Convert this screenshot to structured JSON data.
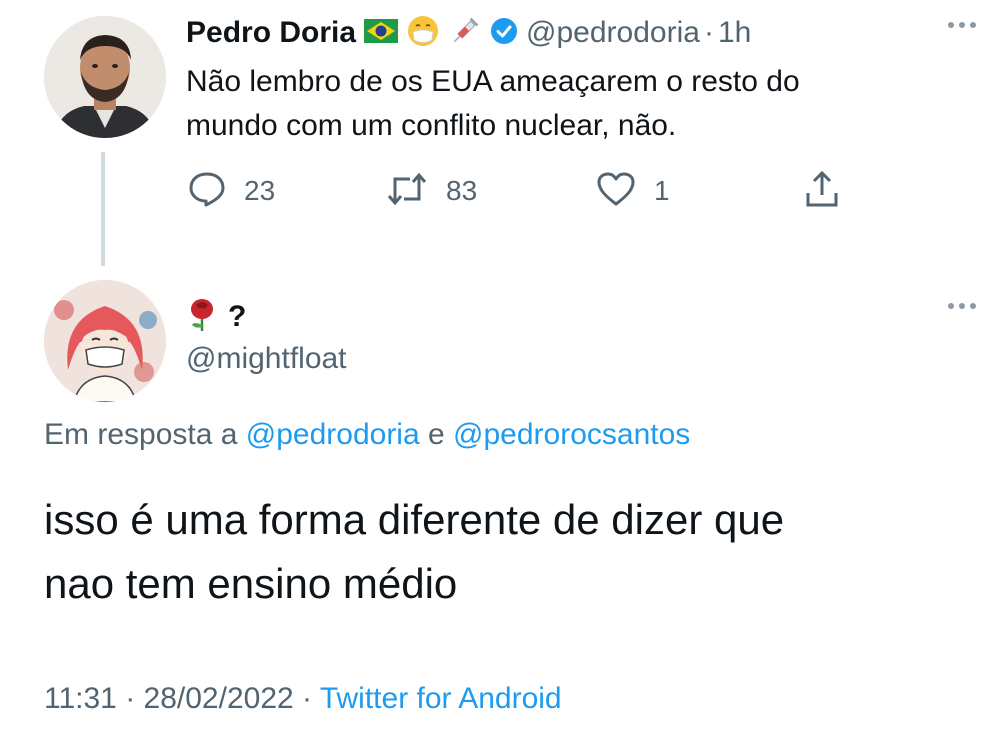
{
  "tweet": {
    "display_name": "Pedro Doria",
    "badges": [
      "brazil-flag-icon",
      "mask-face-emoji-icon",
      "syringe-emoji-icon",
      "verified-badge-icon"
    ],
    "handle": "@pedrodoria",
    "separator": "·",
    "time": "1h",
    "text_line1": "Não lembro de os EUA ameaçarem o resto do",
    "text_line2": "mundo com um conflito nuclear, não.",
    "replies": "23",
    "retweets": "83",
    "likes": "1"
  },
  "reply": {
    "name_emoji": "rose-icon",
    "name_text": "?",
    "handle": "@mightfloat",
    "replying_prefix": "Em resposta a",
    "replying_user1": "@pedrodoria",
    "replying_conj": "e",
    "replying_user2": "@pedrorocsantos",
    "text_line1": "isso é uma forma diferente de dizer que",
    "text_line2": "nao tem ensino médio",
    "time": "11:31",
    "sep": "·",
    "date": "28/02/2022",
    "sep2": "·",
    "source": "Twitter for Android"
  },
  "colors": {
    "text": "#0f1419",
    "secondary": "#536471",
    "link": "#1d9bf0",
    "verified": "#1d9bf0",
    "thread_line": "#cfd9de"
  }
}
